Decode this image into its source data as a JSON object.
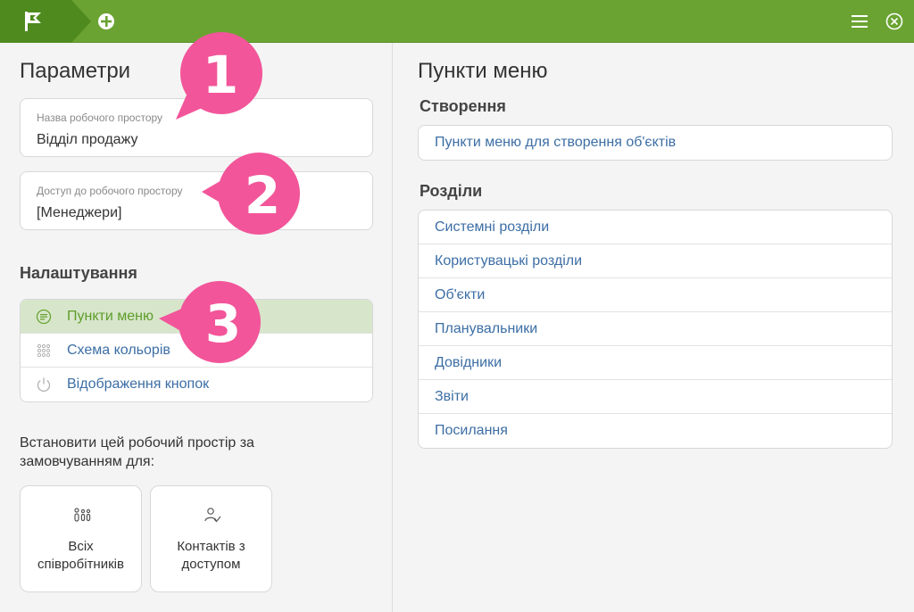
{
  "topbar": {
    "logo_icon": "flag-icon",
    "add_icon": "plus-circle-icon",
    "menu_icon": "hamburger-menu-icon",
    "close_icon": "close-circle-icon",
    "accent_color": "#6aa332"
  },
  "left": {
    "title": "Параметри",
    "workspace_name": {
      "label": "Назва робочого простору",
      "value": "Відділ продажу"
    },
    "workspace_access": {
      "label": "Доступ до робочого простору",
      "value": "[Менеджери]"
    },
    "settings_heading": "Налаштування",
    "settings_items": [
      {
        "label": "Пункти меню",
        "icon": "menu-list-icon",
        "active": true
      },
      {
        "label": "Схема кольорів",
        "icon": "color-grid-icon",
        "active": false
      },
      {
        "label": "Відображення кнопок",
        "icon": "power-icon",
        "active": false
      }
    ],
    "default_text": "Встановити цей робочий простір за замовчуванням для:",
    "default_cards": [
      {
        "label": "Всіх співробітників",
        "icon": "employees-icon"
      },
      {
        "label": "Контактів з доступом",
        "icon": "contact-access-icon"
      }
    ]
  },
  "right": {
    "title": "Пункти меню",
    "create_heading": "Створення",
    "create_items": [
      {
        "label": "Пункти меню для створення об'єктів"
      }
    ],
    "sections_heading": "Розділи",
    "section_items": [
      {
        "label": "Системні розділи"
      },
      {
        "label": "Користувацькі розділи"
      },
      {
        "label": "Об'єкти"
      },
      {
        "label": "Планувальники"
      },
      {
        "label": "Довідники"
      },
      {
        "label": "Звіти"
      },
      {
        "label": "Посилання"
      }
    ]
  },
  "callouts": [
    {
      "number": "1"
    },
    {
      "number": "2"
    },
    {
      "number": "3"
    }
  ],
  "callout_color": "#f2559a"
}
